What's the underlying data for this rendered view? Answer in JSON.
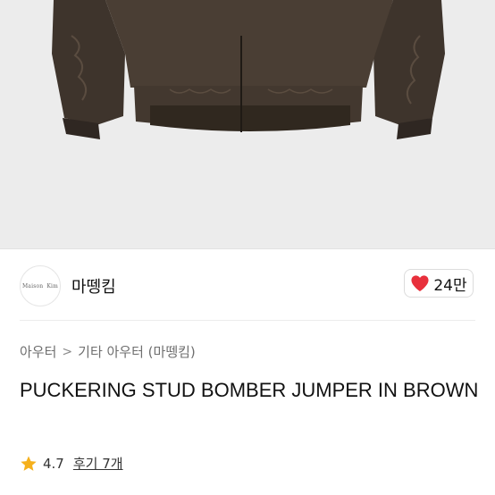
{
  "product": {
    "image_alt": "brown bomber jacket product photo"
  },
  "seller": {
    "avatar_text_left": "Maison",
    "avatar_text_right": "Kim",
    "name": "마뗑킴"
  },
  "like": {
    "icon": "heart-icon",
    "count": "24만",
    "color": "#e8303c"
  },
  "breadcrumb": {
    "items": [
      "아우터",
      "기타 아우터 (마뗑킴)"
    ],
    "separator": ">"
  },
  "title": "PUCKERING STUD BOMBER JUMPER IN BROWN",
  "rating": {
    "icon": "star-icon",
    "value": "4.7",
    "reviews_label": "후기 7개",
    "star_color": "#f5b01c"
  }
}
